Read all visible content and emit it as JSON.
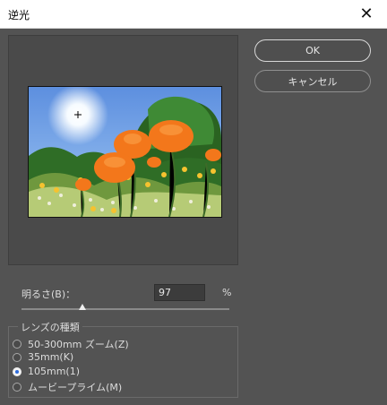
{
  "window": {
    "title": "逆光",
    "close_icon": "close-icon"
  },
  "buttons": {
    "ok": "OK",
    "cancel": "キャンセル"
  },
  "brightness": {
    "label": "明るさ(B)：",
    "value": "97",
    "unit": "%",
    "level_percent": 97
  },
  "lens": {
    "legend": "レンズの種類",
    "options": [
      {
        "label": "50-300mm ズーム(Z)",
        "checked": false
      },
      {
        "label": "35mm(K)",
        "checked": false
      },
      {
        "label": "105mm(1)",
        "checked": true
      },
      {
        "label": "ムービープライム(M)",
        "checked": false
      }
    ]
  },
  "colors": {
    "dialog_bg": "#535353",
    "titlebar_bg": "#ffffff",
    "radio_accent": "#2d6bdc"
  }
}
